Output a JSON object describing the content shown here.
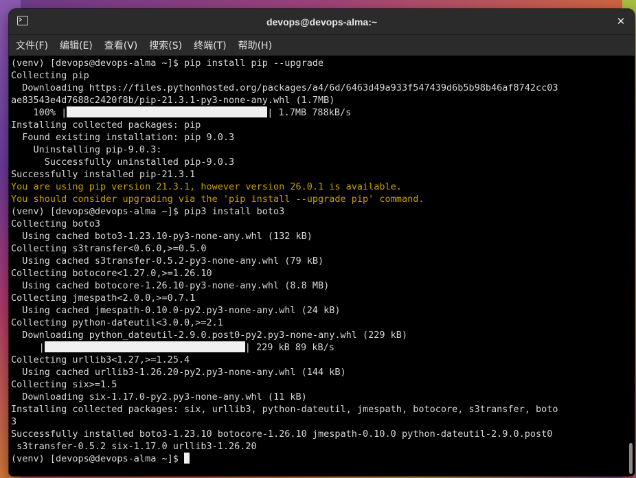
{
  "window": {
    "title": "devops@devops-alma:~"
  },
  "menu": [
    {
      "label": "文件(F)"
    },
    {
      "label": "编辑(E)"
    },
    {
      "label": "查看(V)"
    },
    {
      "label": "搜索(S)"
    },
    {
      "label": "终端(T)"
    },
    {
      "label": "帮助(H)"
    }
  ],
  "terminal": {
    "lines": [
      "(venv) [devops@devops-alma ~]$ pip install pip --upgrade",
      "Collecting pip",
      "  Downloading https://files.pythonhosted.org/packages/a4/6d/6463d49a933f547439d6b5b98b46af8742cc03",
      "ae83543e4d7688c2420f8b/pip-21.3.1-py3-none-any.whl (1.7MB)",
      "",
      "Installing collected packages: pip",
      "  Found existing installation: pip 9.0.3",
      "    Uninstalling pip-9.0.3:",
      "      Successfully uninstalled pip-9.0.3",
      "Successfully installed pip-21.3.1",
      "You are using pip version 21.3.1, however version 26.0.1 is available.",
      "You should consider upgrading via the 'pip install --upgrade pip' command.",
      "(venv) [devops@devops-alma ~]$ pip3 install boto3",
      "Collecting boto3",
      "  Using cached boto3-1.23.10-py3-none-any.whl (132 kB)",
      "Collecting s3transfer<0.6.0,>=0.5.0",
      "  Using cached s3transfer-0.5.2-py3-none-any.whl (79 kB)",
      "Collecting botocore<1.27.0,>=1.26.10",
      "  Using cached botocore-1.26.10-py3-none-any.whl (8.8 MB)",
      "Collecting jmespath<2.0.0,>=0.7.1",
      "  Using cached jmespath-0.10.0-py2.py3-none-any.whl (24 kB)",
      "Collecting python-dateutil<3.0.0,>=2.1",
      "  Downloading python_dateutil-2.9.0.post0-py2.py3-none-any.whl (229 kB)",
      "",
      "Collecting urllib3<1.27,>=1.25.4",
      "  Using cached urllib3-1.26.20-py2.py3-none-any.whl (144 kB)",
      "Collecting six>=1.5",
      "  Downloading six-1.17.0-py2.py3-none-any.whl (11 kB)",
      "Installing collected packages: six, urllib3, python-dateutil, jmespath, botocore, s3transfer, boto",
      "3",
      "Successfully installed boto3-1.23.10 botocore-1.26.10 jmespath-0.10.0 python-dateutil-2.9.0.post0",
      " s3transfer-0.5.2 six-1.17.0 urllib3-1.26.20"
    ],
    "progress1": {
      "prefix": "    100% |",
      "suffix": "| 1.7MB 788kB/s",
      "fraction": 1.0
    },
    "progress2": {
      "prefix": "     |",
      "suffix": "| 229 kB 89 kB/s",
      "fraction": 1.0
    },
    "prompt": "(venv) [devops@devops-alma ~]$ ",
    "warn_color": "#c4a000",
    "text_color": "#d8d8d8"
  }
}
